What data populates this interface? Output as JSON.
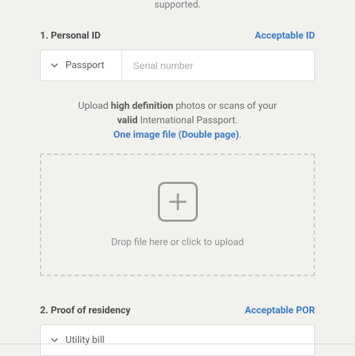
{
  "top_clipped_text": "supported.",
  "section1": {
    "title": "1. Personal ID",
    "accept_link": "Acceptable ID",
    "doc_type": "Passport",
    "serial_placeholder": "Serial number"
  },
  "instructions": {
    "pre": "Upload ",
    "bold1": "high definition",
    "mid1": " photos or scans of your ",
    "bold2": "valid",
    "mid2": " International Passport.",
    "link": "One image file (Double page)",
    "dot": "."
  },
  "dropzone": {
    "text": "Drop file here or click to upload"
  },
  "section2": {
    "title": "2. Proof of residency",
    "accept_link": "Acceptable POR",
    "doc_type": "Utility bill"
  }
}
